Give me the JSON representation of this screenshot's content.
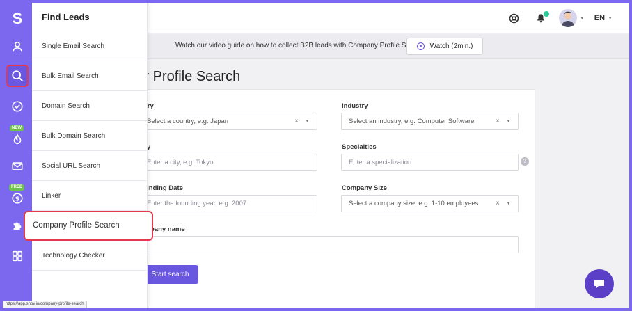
{
  "panel": {
    "title": "Find Leads",
    "items": [
      {
        "label": "Single Email Search"
      },
      {
        "label": "Bulk Email Search"
      },
      {
        "label": "Domain Search"
      },
      {
        "label": "Bulk Domain Search"
      },
      {
        "label": "Social URL Search"
      },
      {
        "label": "Linker"
      },
      {
        "label": "Company Profile Search"
      },
      {
        "label": "Technology Checker"
      }
    ]
  },
  "rail": {
    "logo": "S",
    "badges": {
      "new": "NEW",
      "free": "FREE"
    },
    "accent": "#7b68ee",
    "highlight": "#e53950"
  },
  "header": {
    "language": "EN",
    "icons": [
      "support-icon",
      "bell-icon",
      "avatar",
      "chevron-down-icon"
    ]
  },
  "banner": {
    "text": "Watch our video guide on how to collect B2B leads with Company Profile Search",
    "watch_label": "Watch (2min.)"
  },
  "main": {
    "title": "mpany Profile Search",
    "fields": {
      "country": {
        "label": "untry",
        "placeholder": "Select a country, e.g. Japan"
      },
      "industry": {
        "label": "Industry",
        "placeholder": "Select an industry, e.g. Computer Software"
      },
      "city": {
        "label": "y",
        "placeholder": "Enter a city, e.g. Tokyo"
      },
      "specialties": {
        "label": "Specialties",
        "placeholder": "Enter a specialization"
      },
      "founding": {
        "label": "unding Date",
        "placeholder": "Enter the founding year, e.g. 2007"
      },
      "size": {
        "label": "Company Size",
        "placeholder": "Select a company size, e.g. 1-10 employees"
      },
      "company_name": {
        "label": "pany name",
        "placeholder": ""
      }
    },
    "clear_symbol": "×",
    "help_symbol": "?",
    "start_label": "Start search"
  },
  "status": {
    "url": "https://app.snov.io/company-profile-search"
  }
}
